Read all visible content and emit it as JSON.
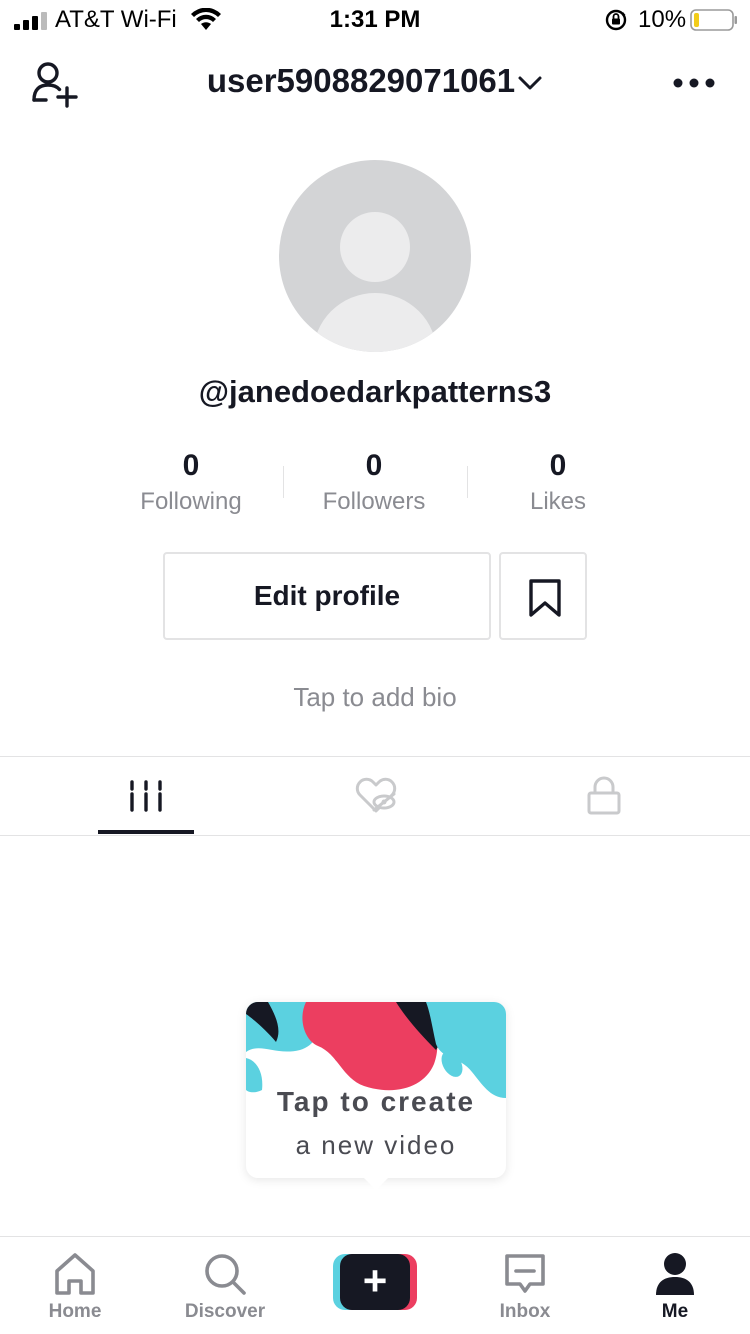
{
  "status_bar": {
    "carrier": "AT&T Wi-Fi",
    "time": "1:31 PM",
    "battery": "10%",
    "icons": [
      "signal-icon",
      "wifi-icon",
      "orientation-lock-icon",
      "battery-icon"
    ]
  },
  "header": {
    "username": "user5908829071061",
    "icons": [
      "add-user-icon",
      "chevron-down-icon",
      "more-icon"
    ]
  },
  "profile": {
    "handle": "@janedoedarkpatterns3",
    "bio_placeholder": "Tap to add bio"
  },
  "stats": [
    {
      "value": "0",
      "label": "Following"
    },
    {
      "value": "0",
      "label": "Followers"
    },
    {
      "value": "0",
      "label": "Likes"
    }
  ],
  "actions": {
    "edit_profile": "Edit profile"
  },
  "tabs": [
    {
      "icon": "grid-icon",
      "active": true
    },
    {
      "icon": "liked-hidden-icon",
      "active": false
    },
    {
      "icon": "lock-icon",
      "active": false
    }
  ],
  "create_prompt": {
    "title": "Tap to create",
    "subtitle": "a new video"
  },
  "bottom_nav": [
    {
      "label": "Home",
      "icon": "home-icon",
      "active": false
    },
    {
      "label": "Discover",
      "icon": "search-icon",
      "active": false
    },
    {
      "label": "",
      "icon": "plus-icon",
      "active": false
    },
    {
      "label": "Inbox",
      "icon": "inbox-icon",
      "active": false
    },
    {
      "label": "Me",
      "icon": "profile-icon",
      "active": true
    }
  ],
  "colors": {
    "text": "#161823",
    "muted": "#8a8b91",
    "border": "#e3e3e4",
    "accent_red": "#ec3e60",
    "accent_cyan": "#5bd1e0"
  }
}
